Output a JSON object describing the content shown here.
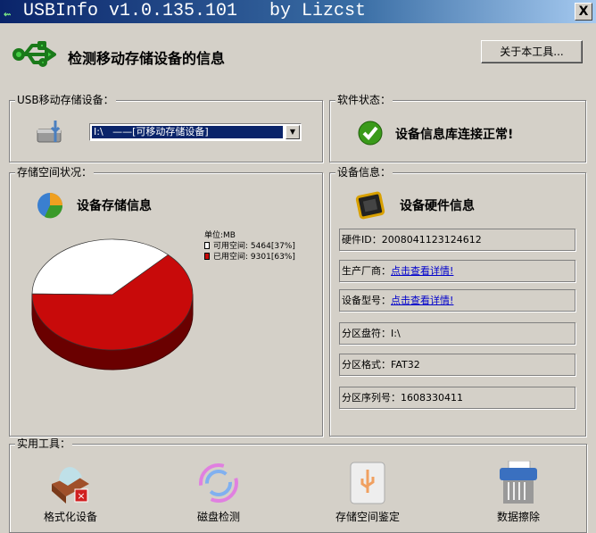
{
  "window": {
    "title": "USBInfo v1.0.135.101   by Lizcst",
    "close": "X"
  },
  "header": {
    "title": "检测移动存储设备的信息",
    "about_button": "关于本工具..."
  },
  "usb_group": {
    "legend": "USB移动存储设备：",
    "selected": "I:\\   ——[可移动存储设备]"
  },
  "status_group": {
    "legend": "软件状态：",
    "message": "设备信息库连接正常!"
  },
  "storage_group": {
    "legend": "存储空间状况：",
    "title": "设备存储信息",
    "unit": "单位:MB",
    "free_label": "可用空间:",
    "free_value": "5464[37%]",
    "used_label": "已用空间:",
    "used_value": "9301[63%]"
  },
  "chart_data": {
    "type": "pie",
    "slices": [
      {
        "name": "可用空间",
        "value": 5464,
        "percent": 37,
        "color": "#ffffff"
      },
      {
        "name": "已用空间",
        "value": 9301,
        "percent": 63,
        "color": "#c80a0a"
      }
    ]
  },
  "device_group": {
    "legend": "设备信息：",
    "title": "设备硬件信息",
    "fields": [
      {
        "label": "硬件ID：",
        "value": "2008041123124612"
      },
      {
        "label": "生产厂商：",
        "link": "点击查看详情!"
      },
      {
        "label": "设备型号：",
        "link": "点击查看详情!"
      },
      {
        "label": "分区盘符：",
        "value": "I:\\"
      },
      {
        "label": "分区格式：",
        "value": "FAT32"
      },
      {
        "label": "分区序列号：",
        "value": "1608330411"
      }
    ]
  },
  "tools_group": {
    "legend": "实用工具：",
    "tools": [
      {
        "label": "格式化设备"
      },
      {
        "label": "磁盘检测"
      },
      {
        "label": "存储空间鉴定"
      },
      {
        "label": "数据擦除"
      }
    ]
  }
}
